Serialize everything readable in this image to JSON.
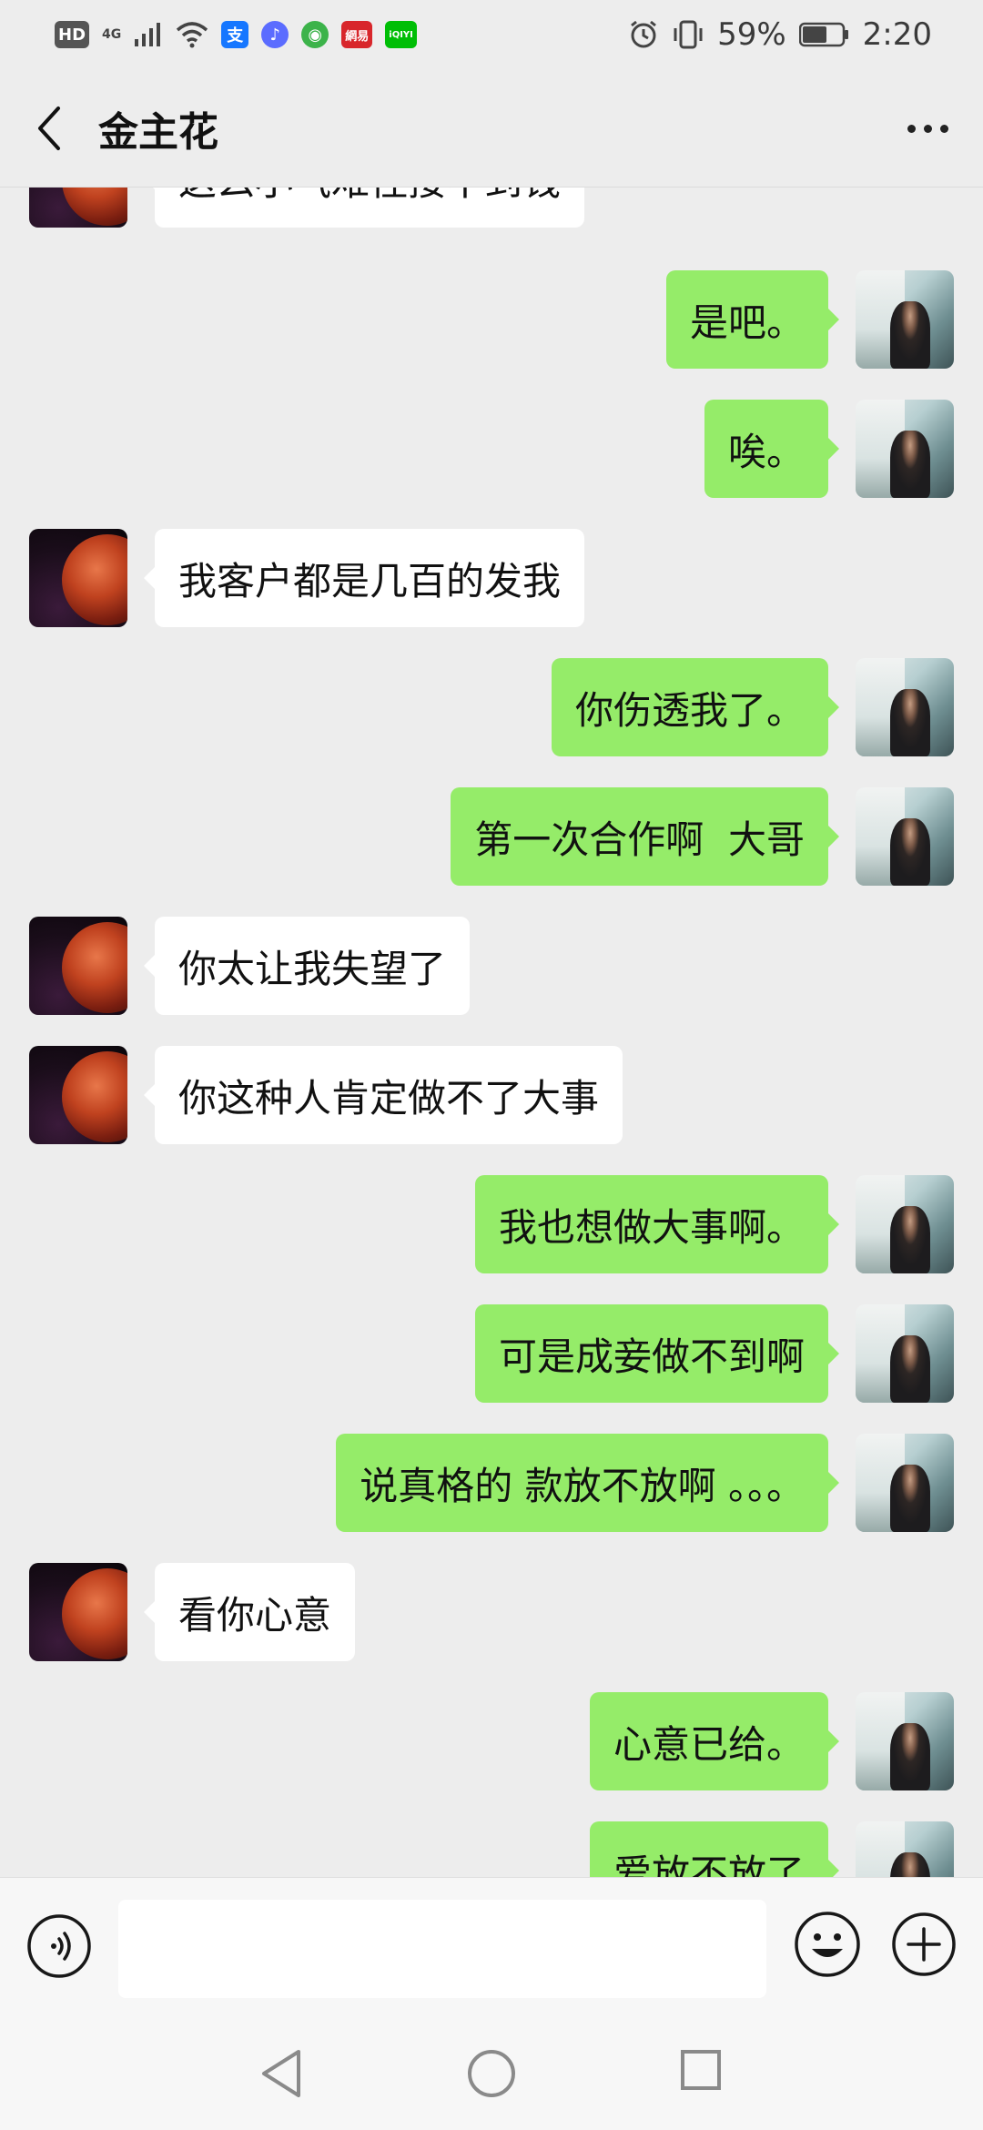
{
  "status_bar": {
    "left_icons": [
      {
        "name": "hd-icon",
        "label": "HD",
        "color": "#555555"
      },
      {
        "name": "network-4g-icon",
        "label": "4G",
        "color": "#444444"
      },
      {
        "name": "signal-icon"
      },
      {
        "name": "wifi-icon"
      },
      {
        "name": "alipay-icon",
        "label": "支",
        "color": "#1677ff"
      },
      {
        "name": "music-icon",
        "label": "♪",
        "color": "#5b6cff"
      },
      {
        "name": "browser-icon",
        "label": "◉",
        "color": "#3cb34a"
      },
      {
        "name": "netease-icon",
        "label": "網易",
        "color": "#d8262b"
      },
      {
        "name": "iqiyi-icon",
        "label": "iQIYI",
        "color": "#00be06"
      }
    ],
    "battery_percent": "59%",
    "time": "2:20"
  },
  "header": {
    "title": "金主花"
  },
  "messages": [
    {
      "side": "in",
      "text": "这么小气难怪接不到钱"
    },
    {
      "side": "out",
      "text": "是吧。"
    },
    {
      "side": "out",
      "text": "唉。"
    },
    {
      "side": "in",
      "text": "我客户都是几百的发我"
    },
    {
      "side": "out",
      "text": "你伤透我了。"
    },
    {
      "side": "out",
      "text": "第一次合作啊  大哥"
    },
    {
      "side": "in",
      "text": "你太让我失望了"
    },
    {
      "side": "in",
      "text": "你这种人肯定做不了大事"
    },
    {
      "side": "out",
      "text": "我也想做大事啊。"
    },
    {
      "side": "out",
      "text": "可是成妾做不到啊"
    },
    {
      "side": "out",
      "text": "说真格的 款放不放啊 。。。"
    },
    {
      "side": "in",
      "text": "看你心意"
    },
    {
      "side": "out",
      "text": "心意已给。"
    },
    {
      "side": "out",
      "text": "爱放不放了"
    }
  ],
  "input": {
    "value": "",
    "placeholder": ""
  },
  "colors": {
    "background": "#ededed",
    "outgoing_bubble": "#95ec69",
    "incoming_bubble": "#ffffff"
  }
}
